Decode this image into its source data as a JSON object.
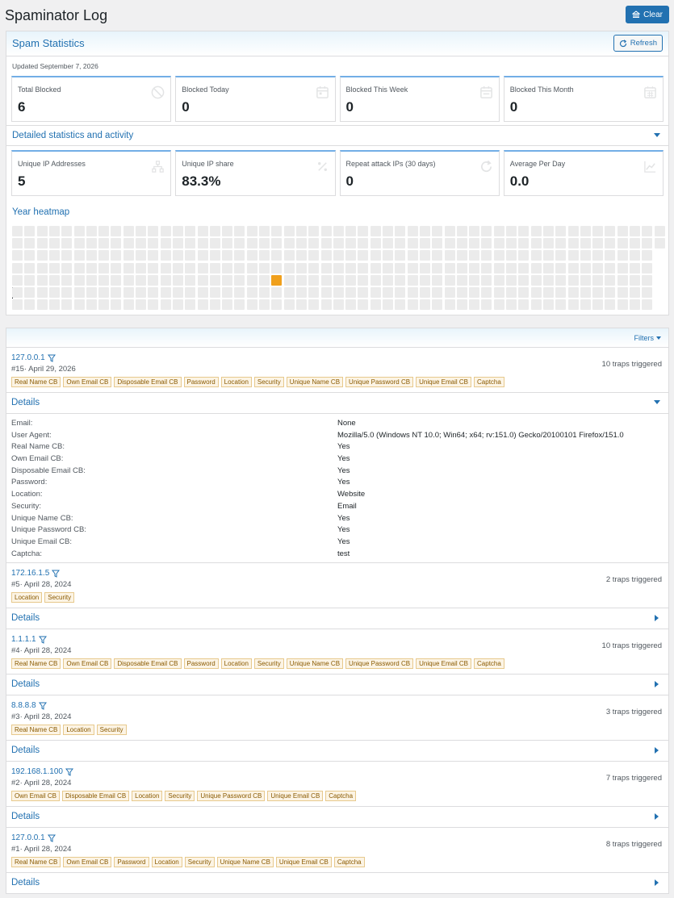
{
  "page": {
    "title": "Spaminator Log",
    "clear_label": "Clear"
  },
  "stats": {
    "title": "Spam Statistics",
    "refresh_label": "Refresh",
    "updated": "Updated September 7, 2026",
    "cards": [
      {
        "label": "Total Blocked",
        "value": "6",
        "icon": "ban-icon"
      },
      {
        "label": "Blocked Today",
        "value": "0",
        "icon": "calendar-day-icon"
      },
      {
        "label": "Blocked This Week",
        "value": "0",
        "icon": "calendar-week-icon"
      },
      {
        "label": "Blocked This Month",
        "value": "0",
        "icon": "calendar-month-icon"
      }
    ],
    "detailed_title": "Detailed statistics and activity",
    "cards2": [
      {
        "label": "Unique IP Addresses",
        "value": "5",
        "icon": "network-icon"
      },
      {
        "label": "Unique IP share",
        "value": "83.3%",
        "icon": "percent-icon"
      },
      {
        "label": "Repeat attack IPs (30 days)",
        "value": "0",
        "icon": "redo-icon"
      },
      {
        "label": "Average Per Day",
        "value": "0.0",
        "icon": "chart-line-icon"
      }
    ],
    "heatmap_title": "Year heatmap",
    "heatmap": {
      "weeks": 53,
      "days": 7,
      "hot_week": 21,
      "hot_day": 4,
      "last_week_days": 2,
      "hot_color": "#f0a01c",
      "empty_color": "#ebebeb"
    }
  },
  "log": {
    "filters_label": "Filters",
    "details_label": "Details",
    "entries": [
      {
        "ip": "127.0.0.1",
        "meta": "#15· April 29, 2026",
        "traps": "10 traps triggered",
        "tags": [
          "Real Name CB",
          "Own Email CB",
          "Disposable Email CB",
          "Password",
          "Location",
          "Security",
          "Unique Name CB",
          "Unique Password CB",
          "Unique Email CB",
          "Captcha"
        ],
        "expanded": true,
        "details": [
          {
            "k": "Email:",
            "v": "None"
          },
          {
            "k": "User Agent:",
            "v": "Mozilla/5.0 (Windows NT 10.0; Win64; x64; rv:151.0) Gecko/20100101 Firefox/151.0"
          },
          {
            "k": "Real Name CB:",
            "v": "Yes"
          },
          {
            "k": "Own Email CB:",
            "v": "Yes"
          },
          {
            "k": "Disposable Email CB:",
            "v": "Yes"
          },
          {
            "k": "Password:",
            "v": "Yes"
          },
          {
            "k": "Location:",
            "v": "Website"
          },
          {
            "k": "Security:",
            "v": "Email"
          },
          {
            "k": "Unique Name CB:",
            "v": "Yes"
          },
          {
            "k": "Unique Password CB:",
            "v": "Yes"
          },
          {
            "k": "Unique Email CB:",
            "v": "Yes"
          },
          {
            "k": "Captcha:",
            "v": "test"
          }
        ]
      },
      {
        "ip": "172.16.1.5",
        "meta": "#5· April 28, 2024",
        "traps": "2 traps triggered",
        "tags": [
          "Location",
          "Security"
        ],
        "expanded": false,
        "details": []
      },
      {
        "ip": "1.1.1.1",
        "meta": "#4· April 28, 2024",
        "traps": "10 traps triggered",
        "tags": [
          "Real Name CB",
          "Own Email CB",
          "Disposable Email CB",
          "Password",
          "Location",
          "Security",
          "Unique Name CB",
          "Unique Password CB",
          "Unique Email CB",
          "Captcha"
        ],
        "expanded": false,
        "details": []
      },
      {
        "ip": "8.8.8.8",
        "meta": "#3· April 28, 2024",
        "traps": "3 traps triggered",
        "tags": [
          "Real Name CB",
          "Location",
          "Security"
        ],
        "expanded": false,
        "details": []
      },
      {
        "ip": "192.168.1.100",
        "meta": "#2· April 28, 2024",
        "traps": "7 traps triggered",
        "tags": [
          "Own Email CB",
          "Disposable Email CB",
          "Location",
          "Security",
          "Unique Password CB",
          "Unique Email CB",
          "Captcha"
        ],
        "expanded": false,
        "details": []
      },
      {
        "ip": "127.0.0.1",
        "meta": "#1· April 28, 2024",
        "traps": "8 traps triggered",
        "tags": [
          "Real Name CB",
          "Own Email CB",
          "Password",
          "Location",
          "Security",
          "Unique Name CB",
          "Unique Email CB",
          "Captcha"
        ],
        "expanded": false,
        "details": []
      }
    ]
  }
}
